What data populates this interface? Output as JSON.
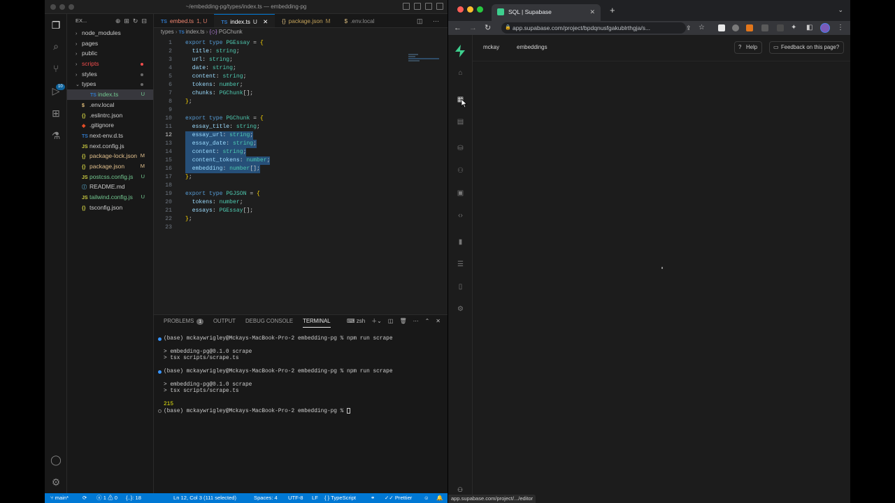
{
  "vscode": {
    "window_title": "~/embedding-pg/types/index.ts — embedding-pg",
    "explorer_title": "EX...",
    "activity_badge": "10",
    "files": [
      {
        "name": "node_modules",
        "type": "folder",
        "open": false,
        "flag": ""
      },
      {
        "name": "pages",
        "type": "folder",
        "open": false,
        "flag": ""
      },
      {
        "name": "public",
        "type": "folder",
        "open": false,
        "flag": ""
      },
      {
        "name": "scripts",
        "type": "folder",
        "open": false,
        "flag": "dot-red",
        "color": "#f14c4c"
      },
      {
        "name": "styles",
        "type": "folder",
        "open": false,
        "flag": "dot-gray"
      },
      {
        "name": "types",
        "type": "folder",
        "open": true,
        "flag": "dot-gray"
      },
      {
        "name": "index.ts",
        "type": "ts",
        "indent": true,
        "flag": "U",
        "selected": true
      },
      {
        "name": ".env.local",
        "type": "env",
        "flag": ""
      },
      {
        "name": ".eslintrc.json",
        "type": "json",
        "flag": ""
      },
      {
        "name": ".gitignore",
        "type": "git",
        "flag": ""
      },
      {
        "name": "next-env.d.ts",
        "type": "ts",
        "flag": ""
      },
      {
        "name": "next.config.js",
        "type": "js",
        "flag": ""
      },
      {
        "name": "package-lock.json",
        "type": "json",
        "flag": "M"
      },
      {
        "name": "package.json",
        "type": "json",
        "flag": "M"
      },
      {
        "name": "postcss.config.js",
        "type": "js",
        "flag": "U"
      },
      {
        "name": "README.md",
        "type": "md",
        "flag": ""
      },
      {
        "name": "tailwind.config.js",
        "type": "js",
        "flag": "U"
      },
      {
        "name": "tsconfig.json",
        "type": "json",
        "flag": ""
      }
    ],
    "tabs": [
      {
        "label": "embed.ts",
        "suffix": "1, U",
        "kind": "ts",
        "active": false,
        "color": "#f48771"
      },
      {
        "label": "index.ts",
        "suffix": "U",
        "kind": "ts",
        "active": true,
        "color": "#ffffff"
      },
      {
        "label": "package.json",
        "suffix": "M",
        "kind": "json",
        "active": false,
        "color": "#c5a35a"
      },
      {
        "label": ".env.local",
        "suffix": "",
        "kind": "env",
        "active": false,
        "color": "#8b8b8b"
      }
    ],
    "breadcrumb": [
      "types",
      "index.ts",
      "PGChunk"
    ],
    "code_lines": [
      "export type PGEssay = {",
      "  title: string;",
      "  url: string;",
      "  date: string;",
      "  content: string;",
      "  tokens: number;",
      "  chunks: PGChunk[];",
      "};",
      "",
      "export type PGChunk = {",
      "  essay_title: string;",
      "  essay_url: string;",
      "  essay_date: string;",
      "  content: string;",
      "  content_tokens: number;",
      "  embedding: number[];",
      "};",
      "",
      "export type PGJSON = {",
      "  tokens: number;",
      "  essays: PGEssay[];",
      "};",
      ""
    ],
    "current_line": 12,
    "panel": {
      "tabs": [
        "PROBLEMS",
        "OUTPUT",
        "DEBUG CONSOLE",
        "TERMINAL"
      ],
      "problems_count": "1",
      "active_tab": "TERMINAL",
      "shell": "zsh",
      "terminal_lines": [
        {
          "text": "(base) mckaywrigley@Mckays-MacBook-Pro-2 embedding-pg % npm run scrape",
          "dot": "blue"
        },
        {
          "text": "",
          "dot": ""
        },
        {
          "text": "> embedding-pg@0.1.0 scrape",
          "dot": ""
        },
        {
          "text": "> tsx scripts/scrape.ts",
          "dot": ""
        },
        {
          "text": "",
          "dot": ""
        },
        {
          "text": "(base) mckaywrigley@Mckays-MacBook-Pro-2 embedding-pg % npm run scrape",
          "dot": "blue"
        },
        {
          "text": "",
          "dot": ""
        },
        {
          "text": "> embedding-pg@0.1.0 scrape",
          "dot": ""
        },
        {
          "text": "> tsx scripts/scrape.ts",
          "dot": ""
        },
        {
          "text": "",
          "dot": ""
        },
        {
          "text": "215",
          "dot": "",
          "yellow": true
        },
        {
          "text": "(base) mckaywrigley@Mckays-MacBook-Pro-2 embedding-pg % ",
          "dot": "hollow",
          "cursor": true
        }
      ]
    },
    "status": {
      "branch": "main*",
      "errors": "1",
      "warnings": "0",
      "braces": "{..}: 18",
      "position": "Ln 12, Col 3 (111 selected)",
      "spaces": "Spaces: 4",
      "encoding": "UTF-8",
      "eol": "LF",
      "language": "TypeScript",
      "prettier": "Prettier"
    }
  },
  "browser": {
    "tab_title": "SQL | Supabase",
    "url": "app.supabase.com/project/bpdqnusfgakublrthgja/s...",
    "hover_url": "app.supabase.com/project/.../editor",
    "brand_color": "#3ecf8e",
    "supabase": {
      "breadcrumb": [
        "mckay",
        "embeddings"
      ],
      "help_label": "Help",
      "feedback_label": "Feedback on this page?",
      "rail_icons": [
        "home-icon",
        "table-editor-icon",
        "sql-editor-icon",
        "database-icon",
        "auth-icon",
        "storage-icon",
        "edge-functions-icon",
        "reports-icon",
        "logs-icon",
        "api-docs-icon",
        "settings-icon"
      ]
    }
  }
}
